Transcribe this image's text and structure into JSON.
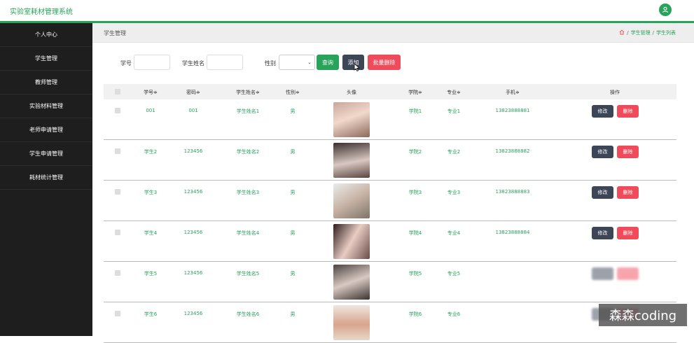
{
  "app": {
    "title": "实验室耗材管理系统"
  },
  "sidebar": {
    "items": [
      {
        "label": "个人中心"
      },
      {
        "label": "学生管理"
      },
      {
        "label": "教师管理"
      },
      {
        "label": "实验材料管理"
      },
      {
        "label": "老师申请管理"
      },
      {
        "label": "学生申请管理"
      },
      {
        "label": "耗材统计管理"
      }
    ]
  },
  "page": {
    "title": "学生管理"
  },
  "breadcrumb": {
    "items": [
      "学生管理",
      "学生列表"
    ],
    "separator": "/"
  },
  "search": {
    "student_no_label": "学号",
    "student_name_label": "学生姓名",
    "gender_label": "性别",
    "query_button": "查询",
    "add_button": "添加",
    "batch_delete_button": "批量删除"
  },
  "table": {
    "headers": [
      "学号≑",
      "密码≑",
      "学生姓名≑",
      "性别≑",
      "头像",
      "学院≑",
      "专业≑",
      "手机≑",
      "操作"
    ],
    "rows": [
      {
        "no": "001",
        "password": "001",
        "name": "学生姓名1",
        "gender": "男",
        "college": "学院1",
        "major": "专业1",
        "phone": "13823888881"
      },
      {
        "no": "学生2",
        "password": "123456",
        "name": "学生姓名2",
        "gender": "男",
        "college": "学院2",
        "major": "专业2",
        "phone": "13823888882"
      },
      {
        "no": "学生3",
        "password": "123456",
        "name": "学生姓名3",
        "gender": "男",
        "college": "学院3",
        "major": "专业3",
        "phone": "13823888883"
      },
      {
        "no": "学生4",
        "password": "123456",
        "name": "学生姓名4",
        "gender": "男",
        "college": "学院4",
        "major": "专业4",
        "phone": "13823888884"
      },
      {
        "no": "学生5",
        "password": "123456",
        "name": "学生姓名5",
        "gender": "男",
        "college": "学院5",
        "major": "专业5",
        "phone": ""
      },
      {
        "no": "学生6",
        "password": "123456",
        "name": "学生姓名6",
        "gender": "男",
        "college": "学院6",
        "major": "专业6",
        "phone": ""
      }
    ],
    "edit_label": "修改",
    "delete_label": "删除"
  },
  "watermark": "森森coding",
  "colors": {
    "accent": "#27a35a",
    "sidebar": "#1e1e1e",
    "danger": "#f04b5b",
    "slate": "#3d4657"
  }
}
